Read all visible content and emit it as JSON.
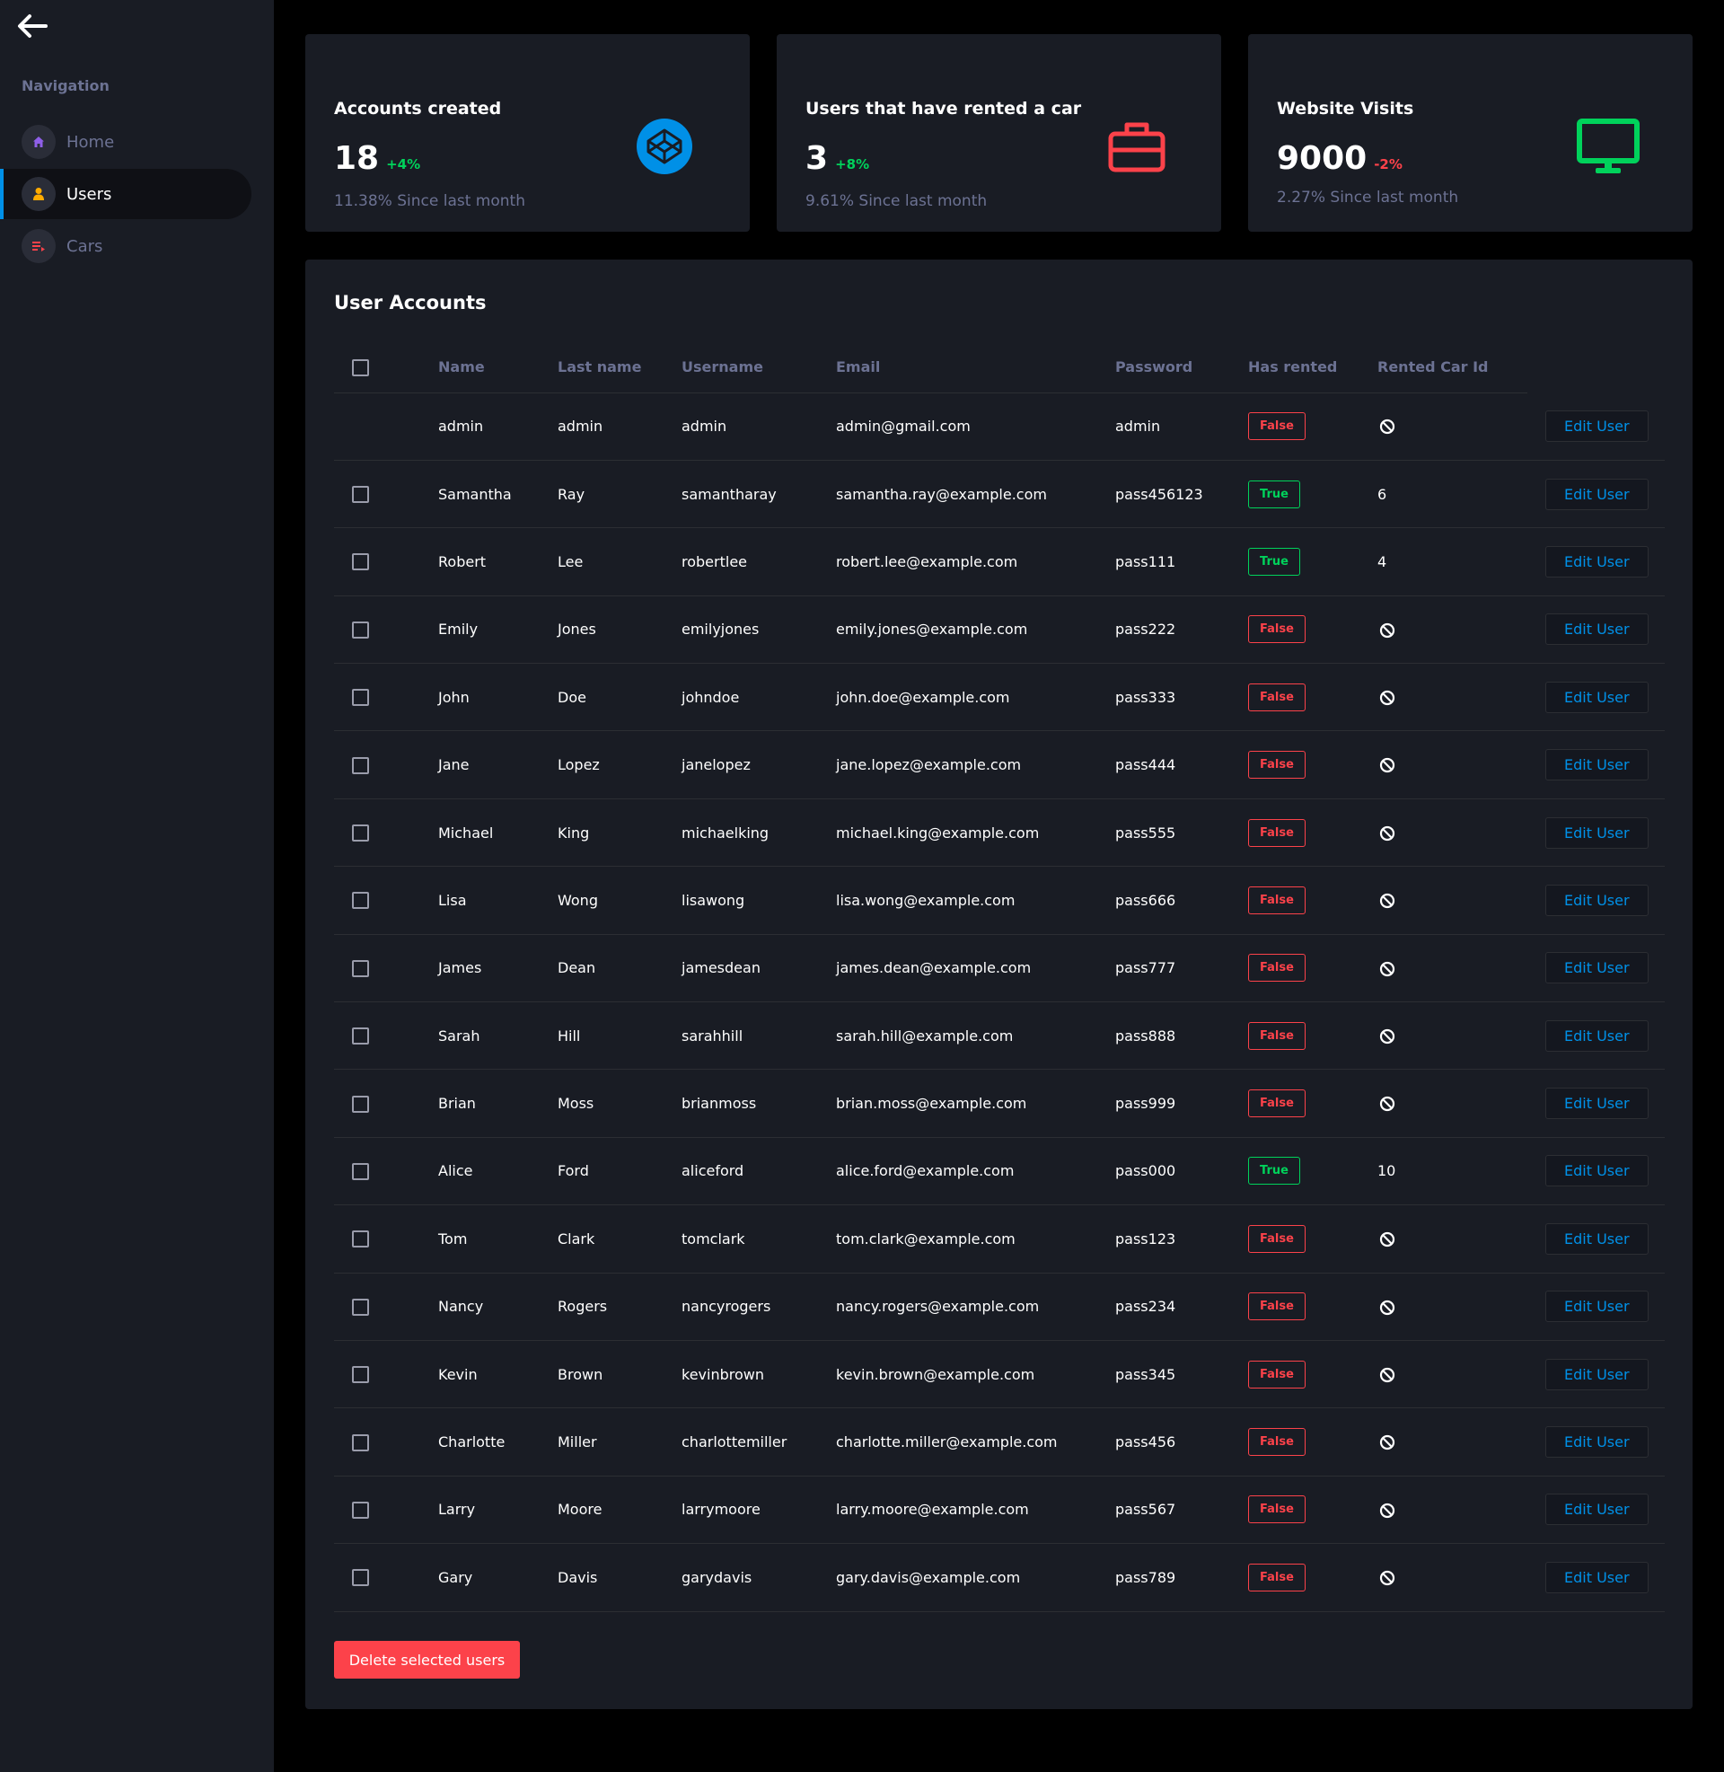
{
  "sidebar": {
    "caption": "Navigation",
    "items": [
      {
        "label": "Home",
        "icon": "home-icon",
        "color": "#8f5fe8"
      },
      {
        "label": "Users",
        "icon": "user-icon",
        "color": "#ffab00"
      },
      {
        "label": "Cars",
        "icon": "playlist-icon",
        "color": "#fc424a"
      }
    ],
    "active": "Users"
  },
  "stats": [
    {
      "title": "Accounts created",
      "value": "18",
      "change": "+4%",
      "change_color": "#00d25b",
      "sub": "11.38% Since last month",
      "icon": "codepen-icon",
      "icon_color": "#0090e7"
    },
    {
      "title": "Users that have rented a car",
      "value": "3",
      "change": "+8%",
      "change_color": "#00d25b",
      "sub": "9.61% Since last month",
      "icon": "briefcase-icon",
      "icon_color": "#fc424a"
    },
    {
      "title": "Website Visits",
      "value": "9000",
      "change": "-2%",
      "change_color": "#fc424a",
      "sub": "2.27% Since last month",
      "icon": "monitor-icon",
      "icon_color": "#00d25b"
    }
  ],
  "table": {
    "title": "User Accounts",
    "columns": [
      "Name",
      "Last name",
      "Username",
      "Email",
      "Password",
      "Has rented",
      "Rented Car Id"
    ],
    "edit_label": "Edit User",
    "rows": [
      {
        "name": "admin",
        "last": "admin",
        "username": "admin",
        "email": "admin@gmail.com",
        "password": "admin",
        "rented": "False",
        "car_id": "",
        "checkbox": false
      },
      {
        "name": "Samantha",
        "last": "Ray",
        "username": "samantharay",
        "email": "samantha.ray@example.com",
        "password": "pass456123",
        "rented": "True",
        "car_id": "6",
        "checkbox": true
      },
      {
        "name": "Robert",
        "last": "Lee",
        "username": "robertlee",
        "email": "robert.lee@example.com",
        "password": "pass111",
        "rented": "True",
        "car_id": "4",
        "checkbox": true
      },
      {
        "name": "Emily",
        "last": "Jones",
        "username": "emilyjones",
        "email": "emily.jones@example.com",
        "password": "pass222",
        "rented": "False",
        "car_id": "",
        "checkbox": true
      },
      {
        "name": "John",
        "last": "Doe",
        "username": "johndoe",
        "email": "john.doe@example.com",
        "password": "pass333",
        "rented": "False",
        "car_id": "",
        "checkbox": true
      },
      {
        "name": "Jane",
        "last": "Lopez",
        "username": "janelopez",
        "email": "jane.lopez@example.com",
        "password": "pass444",
        "rented": "False",
        "car_id": "",
        "checkbox": true
      },
      {
        "name": "Michael",
        "last": "King",
        "username": "michaelking",
        "email": "michael.king@example.com",
        "password": "pass555",
        "rented": "False",
        "car_id": "",
        "checkbox": true
      },
      {
        "name": "Lisa",
        "last": "Wong",
        "username": "lisawong",
        "email": "lisa.wong@example.com",
        "password": "pass666",
        "rented": "False",
        "car_id": "",
        "checkbox": true
      },
      {
        "name": "James",
        "last": "Dean",
        "username": "jamesdean",
        "email": "james.dean@example.com",
        "password": "pass777",
        "rented": "False",
        "car_id": "",
        "checkbox": true
      },
      {
        "name": "Sarah",
        "last": "Hill",
        "username": "sarahhill",
        "email": "sarah.hill@example.com",
        "password": "pass888",
        "rented": "False",
        "car_id": "",
        "checkbox": true
      },
      {
        "name": "Brian",
        "last": "Moss",
        "username": "brianmoss",
        "email": "brian.moss@example.com",
        "password": "pass999",
        "rented": "False",
        "car_id": "",
        "checkbox": true
      },
      {
        "name": "Alice",
        "last": "Ford",
        "username": "aliceford",
        "email": "alice.ford@example.com",
        "password": "pass000",
        "rented": "True",
        "car_id": "10",
        "checkbox": true
      },
      {
        "name": "Tom",
        "last": "Clark",
        "username": "tomclark",
        "email": "tom.clark@example.com",
        "password": "pass123",
        "rented": "False",
        "car_id": "",
        "checkbox": true
      },
      {
        "name": "Nancy",
        "last": "Rogers",
        "username": "nancyrogers",
        "email": "nancy.rogers@example.com",
        "password": "pass234",
        "rented": "False",
        "car_id": "",
        "checkbox": true
      },
      {
        "name": "Kevin",
        "last": "Brown",
        "username": "kevinbrown",
        "email": "kevin.brown@example.com",
        "password": "pass345",
        "rented": "False",
        "car_id": "",
        "checkbox": true
      },
      {
        "name": "Charlotte",
        "last": "Miller",
        "username": "charlottemiller",
        "email": "charlotte.miller@example.com",
        "password": "pass456",
        "rented": "False",
        "car_id": "",
        "checkbox": true
      },
      {
        "name": "Larry",
        "last": "Moore",
        "username": "larrymoore",
        "email": "larry.moore@example.com",
        "password": "pass567",
        "rented": "False",
        "car_id": "",
        "checkbox": true
      },
      {
        "name": "Gary",
        "last": "Davis",
        "username": "garydavis",
        "email": "gary.davis@example.com",
        "password": "pass789",
        "rented": "False",
        "car_id": "",
        "checkbox": true
      }
    ]
  },
  "actions": {
    "delete_label": "Delete selected users"
  },
  "colors": {
    "background": "#000000",
    "panel": "#191c24",
    "muted_text": "#6c7293",
    "accent_blue": "#0090e7",
    "success": "#00d25b",
    "danger": "#fc424a"
  }
}
